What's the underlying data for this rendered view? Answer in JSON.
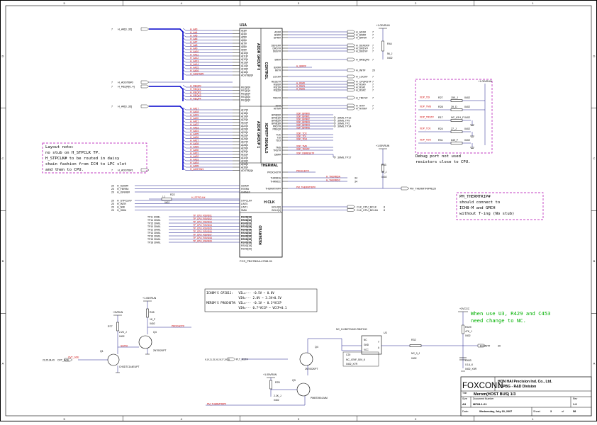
{
  "colors": {
    "wire": "#1a1a8c",
    "bus": "#0000cc",
    "net_label": "#cc0000",
    "pin": "#000000",
    "note_border": "#b000b0",
    "note_text": "#000000",
    "green_note": "#00b000",
    "part": "#000000"
  },
  "border": {
    "rows": [
      "A",
      "B",
      "C",
      "D"
    ],
    "cols": [
      "5",
      "4",
      "3",
      "2",
      "1"
    ]
  },
  "u1": {
    "ref": "U1A",
    "part": "FCS_PBX7BGA-479M-01",
    "blocks": [
      "ADDR GROUP 0",
      "CONTROL",
      "ADDR GROUP 1",
      "XDP/ITP SIGNALS",
      "THERMAL",
      "H CLK",
      "RESERVED"
    ],
    "left_pins_a": [
      "A[3]#",
      "A[4]#",
      "A[5]#",
      "A[6]#",
      "A[7]#",
      "A[8]#",
      "A[9]#",
      "A[10]#",
      "A[11]#",
      "A[12]#",
      "A[13]#",
      "A[14]#",
      "A[15]#",
      "A[16]#",
      "ADSTB[0]#"
    ],
    "left_nets_a": [
      "H_A#3",
      "H_A#4",
      "H_A#5",
      "H_A#6",
      "H_A#7",
      "H_A#8",
      "H_A#9",
      "H_A#10",
      "H_A#11",
      "H_A#12",
      "H_A#13",
      "H_A#14",
      "H_A#15",
      "H_A#16",
      "H_ADSTB#0"
    ],
    "left_pins_b": [
      "REQ[0]#",
      "REQ[1]#",
      "REQ[2]#",
      "REQ[3]#",
      "REQ[4]#"
    ],
    "left_nets_b": [
      "H_REQ#0",
      "H_REQ#1",
      "H_REQ#2",
      "H_REQ#3",
      "H_REQ#4"
    ],
    "left_pins_c": [
      "A[17]#",
      "A[18]#",
      "A[19]#",
      "A[20]#",
      "A[21]#",
      "A[22]#",
      "A[23]#",
      "A[24]#",
      "A[25]#",
      "A[26]#",
      "A[27]#",
      "A[28]#",
      "A[29]#",
      "A[30]#",
      "A[31]#",
      "A[32]#",
      "A[33]#",
      "A[34]#",
      "A[35]#",
      "ADSTB[1]#"
    ],
    "left_nets_c": [
      "H_A#17",
      "H_A#18",
      "H_A#19",
      "H_A#20",
      "H_A#21",
      "H_A#22",
      "H_A#23",
      "H_A#24",
      "H_A#25",
      "H_A#26",
      "H_A#27",
      "H_A#28",
      "H_A#29",
      "H_A#30",
      "H_A#31",
      "H_A#32",
      "H_A#33",
      "H_A#34",
      "H_A#35",
      "H_ADSTB#1"
    ],
    "left_pins_d": [
      "A20M#",
      "FERR#",
      "IGNNE#"
    ],
    "left_nets_d": [
      "H_A20M#",
      "H_FERR#",
      "H_IGNNE#"
    ],
    "left_pins_e": [
      "STPCLK#",
      "LINT0",
      "LINT1",
      "SMI#"
    ],
    "left_nets_e": [
      "H_STPCLK#",
      "H_INTR",
      "H_NMI",
      "H_SMI#"
    ],
    "left_pins_f": [
      "RSVD[01]",
      "RSVD[02]",
      "RSVD[03]",
      "RSVD[04]",
      "RSVD[05]",
      "RSVD[06]",
      "RSVD[07]",
      "RSVD[08]",
      "RSVD[09]"
    ],
    "tp_refs": [
      "TP11 30MIL",
      "TP14 30MIL",
      "TP15 30MIL",
      "TP10 30MIL",
      "TP12 30MIL",
      "TP13 30MIL",
      "TP16 30MIL",
      "TP15 30MIL",
      "TP18 30MIL"
    ],
    "tp_nets": [
      "TP_CPU_RSVD01",
      "TP_CPU_RSVD02",
      "TP_CPU_RSVD03",
      "TP_CPU_RSVD04",
      "TP_CPU_RSVD05",
      "TP_CPU_RSVD06",
      "TP_CPU_RSVD07",
      "TP_CPU_RSVD08",
      "TP_CPU_RSVD09"
    ],
    "right_pins_a": [
      "ADS#",
      "BNR#",
      "BPRI#",
      "DEFER#",
      "DRDY#",
      "DBSY#",
      "BR0#",
      "IERR#",
      "INIT#",
      "LOCK#",
      "RESET#",
      "RS[0]#",
      "RS[1]#",
      "RS[2]#",
      "TRDY#",
      "HIT#",
      "HITM#"
    ],
    "right_nets_a": [
      "H_ADS#",
      "H_BNR#",
      "H_BPRI#",
      "H_DEFER#",
      "H_DRDY#",
      "H_DBSY#",
      "H_BREQ#0",
      "",
      "H_INIT#",
      "H_LOCK#",
      "H_CPURST#",
      "H_RS#0",
      "H_RS#1",
      "H_RS#2",
      "H_TRDY#",
      "H_HIT#",
      "H_HITM#"
    ],
    "right_pins_b": [
      "BPM[0]#",
      "BPM[1]#",
      "BPM[2]#",
      "BPM[3]#",
      "PRDY#",
      "PREQ#",
      "TCK",
      "TDI",
      "TDO",
      "TMS",
      "TRST#",
      "DBR#"
    ],
    "right_nets_b": [
      "XDP_BPM#0",
      "XDP_BPM#1",
      "XDP_BPM#2",
      "XDP_BPM#3",
      "XDP_BPM#4",
      "XDP_BPM#5",
      "XDP_TCK",
      "XDP_TDI",
      "XDP_TDO",
      "XDP_TMS",
      "XDP_TRST#",
      "XDP_DBRESET#"
    ],
    "right_pins_c": [
      "PROCHOT#",
      "THRMDA",
      "THRMDC",
      "THERMTRIP#"
    ],
    "right_nets_c": [
      "PROCHOT#",
      "H_THERMDA",
      "H_THERMDC",
      "PM_THERMTRIP#"
    ],
    "right_pins_d": [
      "BCLK[0]",
      "BCLK[1]"
    ],
    "right_nets_d": [
      "CLK_CPU_BCLK",
      "CLK_CPU_BCLK#"
    ],
    "right_pins_e": [
      "RSVD[10]",
      "RSVD[11]",
      "RSVD[12]",
      "RSVD[13]",
      "RSVD[14]",
      "RSVD[15]",
      "RSVD[16]",
      "RSVD[17]",
      "RSVD[18]",
      "RSVD[19]",
      "RSVD[20]"
    ]
  },
  "left_bus_labels": [
    {
      "text": "H_A#[3..35]",
      "page": "7"
    },
    {
      "text": "H_ADSTB#0",
      "page": "7"
    },
    {
      "text": "H_REQ#[0..4]",
      "page": "7"
    },
    {
      "text": "H_A#[3..35]",
      "page": "7"
    },
    {
      "text": "H_ADSTB#1",
      "page": "7"
    }
  ],
  "left_page_refs": [
    "20",
    "20",
    "20",
    "20",
    "20",
    "20",
    "20"
  ],
  "r22": {
    "ref": "R22",
    "value": "0402",
    "label": "1   2"
  },
  "right_page_refs": [
    "7",
    "7",
    "7",
    "7",
    "7",
    "7",
    "7",
    "7",
    "20",
    "7",
    "7",
    "7",
    "7",
    "7",
    "7",
    "7",
    "7"
  ],
  "r44": {
    "ref": "R44",
    "value": "56_J",
    "pkg": "0402"
  },
  "r33": {
    "ref": "R33",
    "value": "56_J",
    "pkg": "0402"
  },
  "xdp_testpoints": [
    "30MIL TP12",
    "30MIL TP9",
    "30MIL TP2",
    "30MIL TP14",
    "30MIL TP17"
  ],
  "therm_page": "34",
  "thermtrip_page": "8,20",
  "clk_page": "8",
  "vccp_label": "+1.05VRUN",
  "note1": {
    "title": "Layout note:",
    "lines": [
      "no stub on H_STPCLK TP.",
      "H_STPCLK# to be routed in daisy",
      "chain fashion from ICH to LPC slot",
      "and then to CPU."
    ]
  },
  "debug_box": {
    "resistors": [
      {
        "ref": "R27",
        "value": "150_J",
        "pkg": "0402",
        "net": "XDP_TDI"
      },
      {
        "ref": "R28",
        "value": "39_D",
        "pkg": "0402",
        "net": "XDP_TMS"
      },
      {
        "ref": "R17",
        "value": "NC_63.9_F",
        "pkg": "0402",
        "net": "XDP_TRST#"
      },
      {
        "ref": "R24",
        "value": "27_J",
        "pkg": "0402",
        "net": "XDP_TCK"
      },
      {
        "ref": "R31",
        "value": "649_F",
        "pkg": "0402",
        "net": "XDP_TDO"
      }
    ]
  },
  "debug_note": [
    "Debug port not used",
    "resistors close to  CPU."
  ],
  "thermtrip_note": [
    "PM_THERMTRIP#",
    "should connect to",
    "ICH8-M and GMCH",
    "without T-ing (No stub)"
  ],
  "strap_note": {
    "lines": [
      "ICH8M'S GPIO11:   VIL=--- -0.5V ~ 0.8V",
      "                  VIH=--- 2.0V ~ 3.3V+0.5V",
      "MEROM'S PROCHOT#: VIL=--- -0.1V ~ 0.3*VCCP",
      "                  VIH=--- 0.7*VCCP ~ VCCP+0.1"
    ]
  },
  "green_note": [
    "When use U3, R429 and C453",
    "need change to NC."
  ],
  "bottom_left": {
    "rail": "+3VRUN",
    "rail2": "+1.05VRUN",
    "r77": {
      "ref": "R77",
      "value": "2.2K_J",
      "pkg": "0402"
    },
    "r45": {
      "ref": "R45",
      "value": "1K_F",
      "pkg": "0402"
    },
    "q1": {
      "ref": "Q1",
      "part": "CH3DTC144EUPT"
    },
    "q4a": {
      "ref": "Q4",
      "part": "2N7002KPT"
    },
    "ocsgpio": "OVT_GOE",
    "ocsgpio_pages": "21,25,34,49",
    "prochot_label": "PROCHOT#",
    "net": "SGPIO"
  },
  "bottom_mid": {
    "rail": "+1.05VRUN",
    "r25": {
      "ref": "R25",
      "value": "2.2K_J",
      "pkg": "0402"
    },
    "q3": {
      "ref": "Q3",
      "part": "PMBT3904-MM"
    },
    "q4": {
      "ref": "Q4",
      "part": "2N7002KPT"
    },
    "plt_rst": "PLT_RST#",
    "plt_pages": "8,19,21,25,26,28,27,28,35",
    "thermtrip_net": "PM_THERMTRIP#"
  },
  "bottom_right": {
    "u3_ref": "U3",
    "u3_part": "NC_G-KB2T2LMC-RB4T100",
    "pins_left": [
      "NC",
      "GND",
      "VCC"
    ],
    "pins_right": [
      "Y",
      "A"
    ],
    "c20": {
      "ref": "C20",
      "value": "NC_47NF_50V_K",
      "pkg": "0402_X7R"
    },
    "r32": {
      "ref": "R32",
      "value": "NC_0_J",
      "pkg": "0402"
    },
    "r429": {
      "ref": "R429",
      "value": "47K_J",
      "pkg": "0402"
    },
    "c453": {
      "ref": "C453",
      "value": "0.1U_K",
      "pkg": "0402_X5R"
    },
    "rail": "+3VCCC",
    "out_net": "ECRST#",
    "out_page": "30"
  },
  "title_block": {
    "logo": "FOXCONN",
    "company": "HON HAI Precision Ind. Co., Ltd.",
    "division": "CCPBG - R&D Division",
    "title_label": "Title",
    "title": "Merom(HOST BUS) 1/3",
    "size_label": "Size",
    "size": "A3",
    "doc_label": "Document Number",
    "doc": "MF28-1-01",
    "rev_label": "Rev",
    "rev": "1.0",
    "date_label": "Date:",
    "date": "Wednesday, July 18, 2007",
    "sheet_label": "Sheet",
    "sheet": "3",
    "of": "of",
    "total": "58"
  }
}
